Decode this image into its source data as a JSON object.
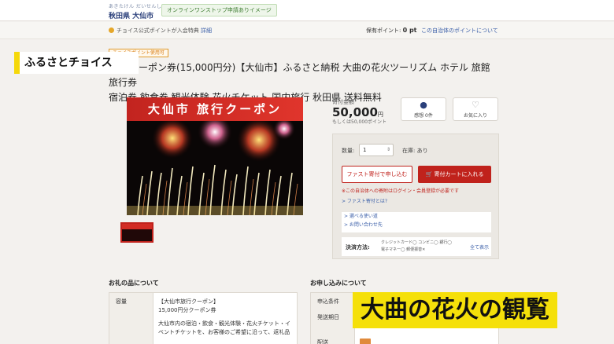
{
  "header": {
    "region_ruby": "あきたけん だいせんし",
    "region_name": "秋田県 大仙市",
    "shop_badge": "オンラインワンストップ申請ありイメージ"
  },
  "subbar": {
    "notice_text": "チョイス公式ポイントが入会特典 ",
    "notice_link": "詳細",
    "points_label": "保有ポイント:",
    "points_value": "0 pt",
    "gov_points_link": "この自治体のポイントについて"
  },
  "program_label": "ふるさとチョイス",
  "item_tag": "チョイスポイント使用可",
  "title_line1": "ーポン券(15,000円分)【大仙市】ふるさと納税 大曲の花火ツーリズム ホテル 旅館 旅行券",
  "title_line2": "宿泊券 飲食券 観光体験 花火チケット 国内旅行 秋田県 送料無料",
  "image": {
    "banner_text": "大仙市 旅行クーポン"
  },
  "pricing": {
    "label": "寄付金額",
    "amount": "50,000",
    "unit": "円",
    "alt_points": "もしくは50,000ポイント"
  },
  "actions": {
    "favorite_label": "感想 0件",
    "bookmark_label": "お気に入り"
  },
  "purchase": {
    "qty_label": "数量:",
    "qty_value": "1",
    "stock_label": "在庫: あり",
    "quick_donate": "ファスト寄付で申し込む",
    "add_to_cart": "寄付カートに入れる",
    "warning": "※この自治体への寄附はログイン・会員登録が必要です",
    "fast_link": "> ファスト寄付とは?",
    "link_compare": "> 選べる使い道",
    "link_contact": "> お問い合わせ先",
    "payment_label": "決済方法:",
    "payment_line1": "クレジットカード◯  コンビニ◯  銀行◯",
    "payment_line2": "電子マネー◯  郵便振替✕",
    "payment_all": "全て表示"
  },
  "details": {
    "heading": "お礼の品について",
    "row_label": "容量",
    "line1": "【大仙市旅行クーポン】",
    "line2": "15,000円分クーポン券",
    "line3": "大仙市内の宿泊・飲食・観光体験・花火チケット・イ",
    "line4": "ベントチケットを、お客様のご希望に沿って、返礼品"
  },
  "application": {
    "heading": "お申し込みについて",
    "row1": "申込条件",
    "row2": "発送期日",
    "row3": "配送"
  },
  "caption": "大曲の花火の観覧"
}
